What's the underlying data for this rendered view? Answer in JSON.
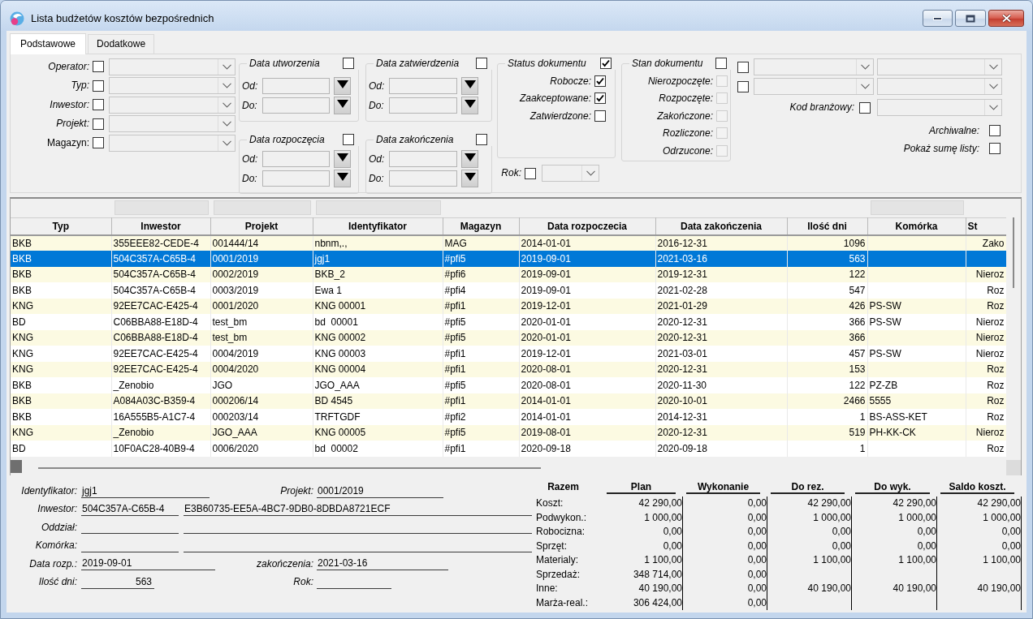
{
  "window": {
    "title": "Lista budżetów kosztów bezpośrednich"
  },
  "tabs": [
    {
      "label": "Podstawowe",
      "selected": true
    },
    {
      "label": "Dodatkowe",
      "selected": false
    }
  ],
  "filters": {
    "basic": [
      {
        "label": "Operator:",
        "checked": false
      },
      {
        "label": "Typ:",
        "checked": false
      },
      {
        "label": "Inwestor:",
        "checked": false
      },
      {
        "label": "Projekt:",
        "checked": false
      },
      {
        "label": "Magazyn:",
        "checked": false
      }
    ],
    "date_groups": [
      {
        "title": "Data utworzenia",
        "checked": false,
        "fields": [
          {
            "label": "Od:"
          },
          {
            "label": "Do:"
          }
        ]
      },
      {
        "title": "Data zatwierdzenia",
        "checked": false,
        "fields": [
          {
            "label": "Od:"
          },
          {
            "label": "Do:"
          }
        ]
      },
      {
        "title": "Data rozpoczęcia",
        "checked": false,
        "fields": [
          {
            "label": "Od:"
          },
          {
            "label": "Do:"
          }
        ]
      },
      {
        "title": "Data zakończenia",
        "checked": false,
        "fields": [
          {
            "label": "Od:"
          },
          {
            "label": "Do:"
          }
        ]
      }
    ],
    "document_status": {
      "title": "Status dokumentu",
      "checked": true,
      "items": [
        {
          "label": "Robocze:",
          "checked": true
        },
        {
          "label": "Zaakceptowane:",
          "checked": true
        },
        {
          "label": "Zatwierdzone:",
          "checked": false
        }
      ]
    },
    "document_state": {
      "title": "Stan dokumentu",
      "checked": false,
      "items": [
        {
          "label": "Nierozpoczęte:",
          "checked": false,
          "disabled": true
        },
        {
          "label": "Rozpoczęte:",
          "checked": false,
          "disabled": true
        },
        {
          "label": "Zakończone:",
          "checked": false,
          "disabled": true
        },
        {
          "label": "Rozliczone:",
          "checked": false,
          "disabled": true
        },
        {
          "label": "Odrzucone:",
          "checked": false,
          "disabled": true
        }
      ]
    },
    "year": {
      "label": "Rok:",
      "checked": false
    },
    "extra": [
      {
        "checked": false
      },
      {
        "checked": false
      }
    ],
    "industry_code": {
      "label": "Kod branżowy:",
      "checked": false
    },
    "options": [
      {
        "label": "Archiwalne:",
        "checked": false
      },
      {
        "label": "Pokaż sumę listy:",
        "checked": false
      }
    ]
  },
  "table": {
    "columns": [
      {
        "label": "Typ",
        "has_filter": false
      },
      {
        "label": "Inwestor",
        "has_filter": true
      },
      {
        "label": "Projekt",
        "has_filter": true
      },
      {
        "label": "Identyfikator",
        "has_filter": true
      },
      {
        "label": "Magazyn",
        "has_filter": false
      },
      {
        "label": "Data rozpoczecia",
        "has_filter": false
      },
      {
        "label": "Data zakończenia",
        "has_filter": false
      },
      {
        "label": "Ilość dni",
        "has_filter": false
      },
      {
        "label": "Komórka",
        "has_filter": true
      },
      {
        "label": "St",
        "has_filter": false
      }
    ],
    "rows": [
      {
        "type": "BKB",
        "investor": "355EEE82-CEDE-4",
        "project": "001444/14",
        "identifier": "nbnm,.,",
        "warehouse": "MAG",
        "start_date": "2014-01-01",
        "end_date": "2016-12-31",
        "days": "1096",
        "column_10": "Zako",
        "selected": false
      },
      {
        "type": "BKB",
        "investor": "504C357A-C65B-4",
        "project": "0001/2019",
        "identifier": "jgj1",
        "warehouse": "#pfi5",
        "start_date": "2019-09-01",
        "end_date": "2021-03-16",
        "days": "563",
        "selected": true
      },
      {
        "type": "BKB",
        "investor": "504C357A-C65B-4",
        "project": "0002/2019",
        "identifier": "BKB_2",
        "warehouse": "#pfi6",
        "start_date": "2019-09-01",
        "end_date": "2019-12-31",
        "days": "122",
        "column_10": "Nieroz",
        "selected": false
      },
      {
        "type": "BKB",
        "investor": "504C357A-C65B-4",
        "project": "0003/2019",
        "identifier": "Ewa 1",
        "warehouse": "#pfi4",
        "start_date": "2019-09-01",
        "end_date": "2021-02-28",
        "days": "547",
        "column_10": "Roz",
        "selected": false
      },
      {
        "type": "KNG",
        "investor": "92EE7CAC-E425-4",
        "project": "0001/2020",
        "identifier": "KNG 00001",
        "warehouse": "#pfi1",
        "start_date": "2019-12-01",
        "end_date": "2021-01-29",
        "days": "426",
        "cell": "PS-SW",
        "column_10": "Roz",
        "selected": false
      },
      {
        "type": "BD",
        "investor": "C06BBA88-E18D-4",
        "project": "test_bm",
        "identifier": "bd  00001",
        "warehouse": "#pfi5",
        "start_date": "2020-01-01",
        "end_date": "2020-12-31",
        "days": "366",
        "cell": "PS-SW",
        "column_10": "Nieroz",
        "selected": false
      },
      {
        "type": "KNG",
        "investor": "C06BBA88-E18D-4",
        "project": "test_bm",
        "identifier": "KNG 00002",
        "warehouse": "#pfi5",
        "start_date": "2020-01-01",
        "end_date": "2020-12-31",
        "days": "366",
        "column_10": "Nieroz",
        "selected": false
      },
      {
        "type": "KNG",
        "investor": "92EE7CAC-E425-4",
        "project": "0004/2019",
        "identifier": "KNG 00003",
        "warehouse": "#pfi1",
        "start_date": "2019-12-01",
        "end_date": "2021-03-01",
        "days": "457",
        "cell": "PS-SW",
        "column_10": "Nieroz",
        "selected": false
      },
      {
        "type": "KNG",
        "investor": "92EE7CAC-E425-4",
        "project": "0004/2020",
        "identifier": "KNG 00004",
        "warehouse": "#pfi1",
        "start_date": "2020-08-01",
        "end_date": "2020-12-31",
        "days": "153",
        "column_10": "Roz",
        "selected": false
      },
      {
        "type": "BKB",
        "investor": "_Zenobio",
        "project": "JGO",
        "identifier": "JGO_AAA",
        "warehouse": "#pfi5",
        "start_date": "2020-08-01",
        "end_date": "2020-11-30",
        "days": "122",
        "cell": "PZ-ZB",
        "column_10": "Roz",
        "selected": false
      },
      {
        "type": "BKB",
        "investor": "A084A03C-B359-4",
        "project": "000206/14",
        "identifier": "BD 4545",
        "warehouse": "#pfi1",
        "start_date": "2014-01-01",
        "end_date": "2020-10-01",
        "days": "2466",
        "cell": "5555",
        "column_10": "Roz",
        "selected": false
      },
      {
        "type": "BKB",
        "investor": "16A555B5-A1C7-4",
        "project": "000203/14",
        "identifier": "TRFTGDF",
        "warehouse": "#pfi2",
        "start_date": "2014-01-01",
        "end_date": "2014-12-31",
        "days": "1",
        "cell": "BS-ASS-KET",
        "column_10": "Roz",
        "selected": false
      },
      {
        "type": "KNG",
        "investor": "_Zenobio",
        "project": "JGO_AAA",
        "identifier": "KNG 00005",
        "warehouse": "#pfi5",
        "start_date": "2019-08-01",
        "end_date": "2020-12-31",
        "days": "519",
        "cell": "PH-KK-CK",
        "column_10": "Nieroz",
        "selected": false
      },
      {
        "type": "BD",
        "investor": "10F0AC28-40B9-4",
        "project": "0006/2020",
        "identifier": "bd  00002",
        "warehouse": "#pfi1",
        "start_date": "2020-09-18",
        "end_date": "2020-09-18",
        "days": "1",
        "column_10": "Roz",
        "selected": false
      }
    ]
  },
  "details": {
    "identifier": {
      "label": "Identyfikator:",
      "value": "jgj1"
    },
    "project": {
      "label": "Projekt:",
      "value": "0001/2019"
    },
    "investor": {
      "label": "Inwestor:",
      "code": "504C357A-C65B-4",
      "name": "E3B60735-EE5A-4BC7-9DB0-8DBDA8721ECF"
    },
    "branch": {
      "label": "Oddział:"
    },
    "cell": {
      "label": "Komórka:"
    },
    "start_date": {
      "label": "Data rozp.:",
      "value": "2019-09-01"
    },
    "end_date": {
      "label": "zakończenia:",
      "value": "2021-03-16"
    },
    "days": {
      "label": "Ilość dni:",
      "value": "563"
    },
    "year": {
      "label": "Rok:"
    }
  },
  "summary": {
    "columns": [
      "Razem",
      "Plan",
      "Wykonanie",
      "Do rez.",
      "Do wyk.",
      "Saldo koszt."
    ],
    "rows": [
      {
        "label": "Koszt:",
        "values": [
          "42 290,00",
          "0,00",
          "42 290,00",
          "42 290,00",
          "42 290,00"
        ]
      },
      {
        "label": "Podwykon.:",
        "values": [
          "1 000,00",
          "0,00",
          "1 000,00",
          "1 000,00",
          "1 000,00"
        ]
      },
      {
        "label": "Robocizna:",
        "values": [
          "0,00",
          "0,00",
          "0,00",
          "0,00",
          "0,00"
        ]
      },
      {
        "label": "Sprzęt:",
        "values": [
          "0,00",
          "0,00",
          "0,00",
          "0,00",
          "0,00"
        ]
      },
      {
        "label": "Materialy:",
        "values": [
          "1 100,00",
          "0,00",
          "1 100,00",
          "1 100,00",
          "1 100,00"
        ]
      },
      {
        "label": "Sprzedaż:",
        "values": [
          "348 714,00",
          "0,00"
        ]
      },
      {
        "label": "Inne:",
        "values": [
          "40 190,00",
          "0,00",
          "40 190,00",
          "40 190,00",
          "40 190,00"
        ]
      },
      {
        "label": "Marża-real.:",
        "values": [
          "306 424,00",
          "0,00"
        ]
      }
    ]
  }
}
